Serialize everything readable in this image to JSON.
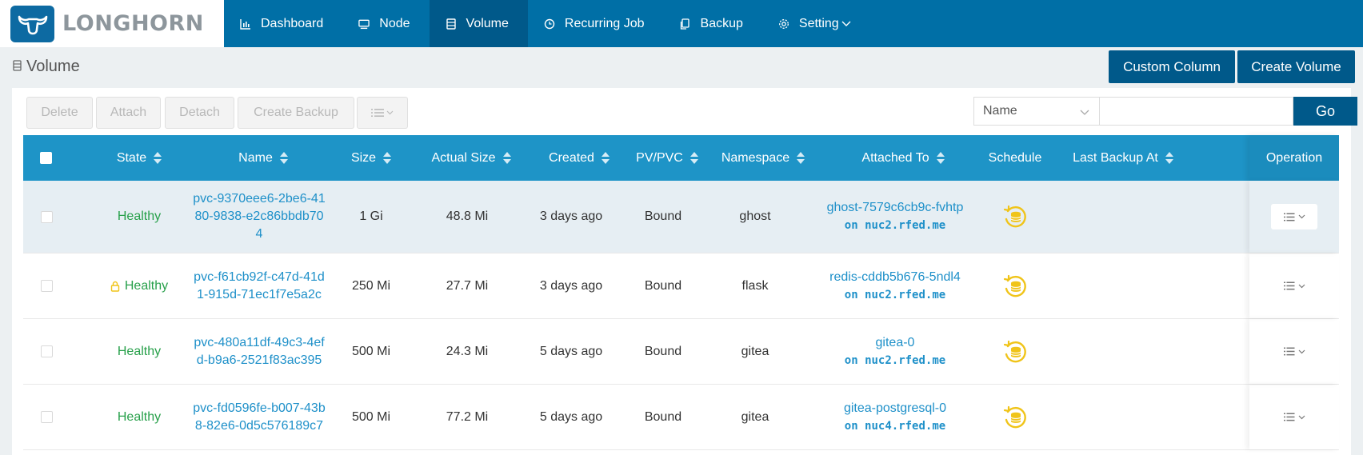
{
  "app": {
    "logo_text": "LONGHORN"
  },
  "nav": [
    {
      "label": "Dashboard",
      "icon": "bar-chart-icon",
      "active": false
    },
    {
      "label": "Node",
      "icon": "monitor-icon",
      "active": false
    },
    {
      "label": "Volume",
      "icon": "database-icon",
      "active": true
    },
    {
      "label": "Recurring Job",
      "icon": "clock-icon",
      "active": false
    },
    {
      "label": "Backup",
      "icon": "copy-icon",
      "active": false
    },
    {
      "label": "Setting",
      "icon": "gear-icon",
      "active": false
    }
  ],
  "page": {
    "title": "Volume",
    "custom_column_label": "Custom Column",
    "create_volume_label": "Create Volume"
  },
  "toolbar": {
    "delete_label": "Delete",
    "attach_label": "Attach",
    "detach_label": "Detach",
    "create_backup_label": "Create Backup"
  },
  "search": {
    "field_selected": "Name",
    "input_value": "",
    "go_label": "Go"
  },
  "table": {
    "headers": {
      "state": "State",
      "name": "Name",
      "size": "Size",
      "actual_size": "Actual Size",
      "created": "Created",
      "pvpvc": "PV/PVC",
      "namespace": "Namespace",
      "attached_to": "Attached To",
      "schedule": "Schedule",
      "last_backup": "Last Backup At",
      "operation": "Operation"
    },
    "rows": [
      {
        "state": "Healthy",
        "name_l1": "pvc-9370eee6-2be6-41",
        "name_l2": "80-9838-e2c86bbdb70",
        "name_l3": "4",
        "size": "1 Gi",
        "actual_size": "48.8 Mi",
        "created": "3 days ago",
        "pvpvc": "Bound",
        "namespace": "ghost",
        "pod": "ghost-7579c6cb9c-fvhtp",
        "node": "on nuc2.rfed.me",
        "last_backup": ""
      },
      {
        "state": "Healthy",
        "name_l1": "pvc-f61cb92f-c47d-41d",
        "name_l2": "1-915d-71ec1f7e5a2c",
        "size": "250 Mi",
        "actual_size": "27.7 Mi",
        "created": "3 days ago",
        "pvpvc": "Bound",
        "namespace": "flask",
        "pod": "redis-cddb5b676-5ndl4",
        "node": "on nuc2.rfed.me",
        "last_backup": ""
      },
      {
        "state": "Healthy",
        "name_l1": "pvc-480a11df-49c3-4ef",
        "name_l2": "d-b9a6-2521f83ac395",
        "size": "500 Mi",
        "actual_size": "24.3 Mi",
        "created": "5 days ago",
        "pvpvc": "Bound",
        "namespace": "gitea",
        "pod": "gitea-0",
        "node": "on nuc2.rfed.me",
        "last_backup": ""
      },
      {
        "state": "Healthy",
        "name_l1": "pvc-fd0596fe-b007-43b",
        "name_l2": "8-82e6-0d5c576189c7",
        "size": "500 Mi",
        "actual_size": "77.2 Mi",
        "created": "5 days ago",
        "pvpvc": "Bound",
        "namespace": "gitea",
        "pod": "gitea-postgresql-0",
        "node": "on nuc4.rfed.me",
        "last_backup": ""
      }
    ]
  },
  "colors": {
    "nav_bg": "#006fa6",
    "nav_active": "#00598a",
    "table_header": "#1e94c7",
    "healthy": "#27a04a",
    "link": "#1e90c9",
    "schedule_icon": "#f0c419",
    "lock_icon": "#f0c419"
  }
}
